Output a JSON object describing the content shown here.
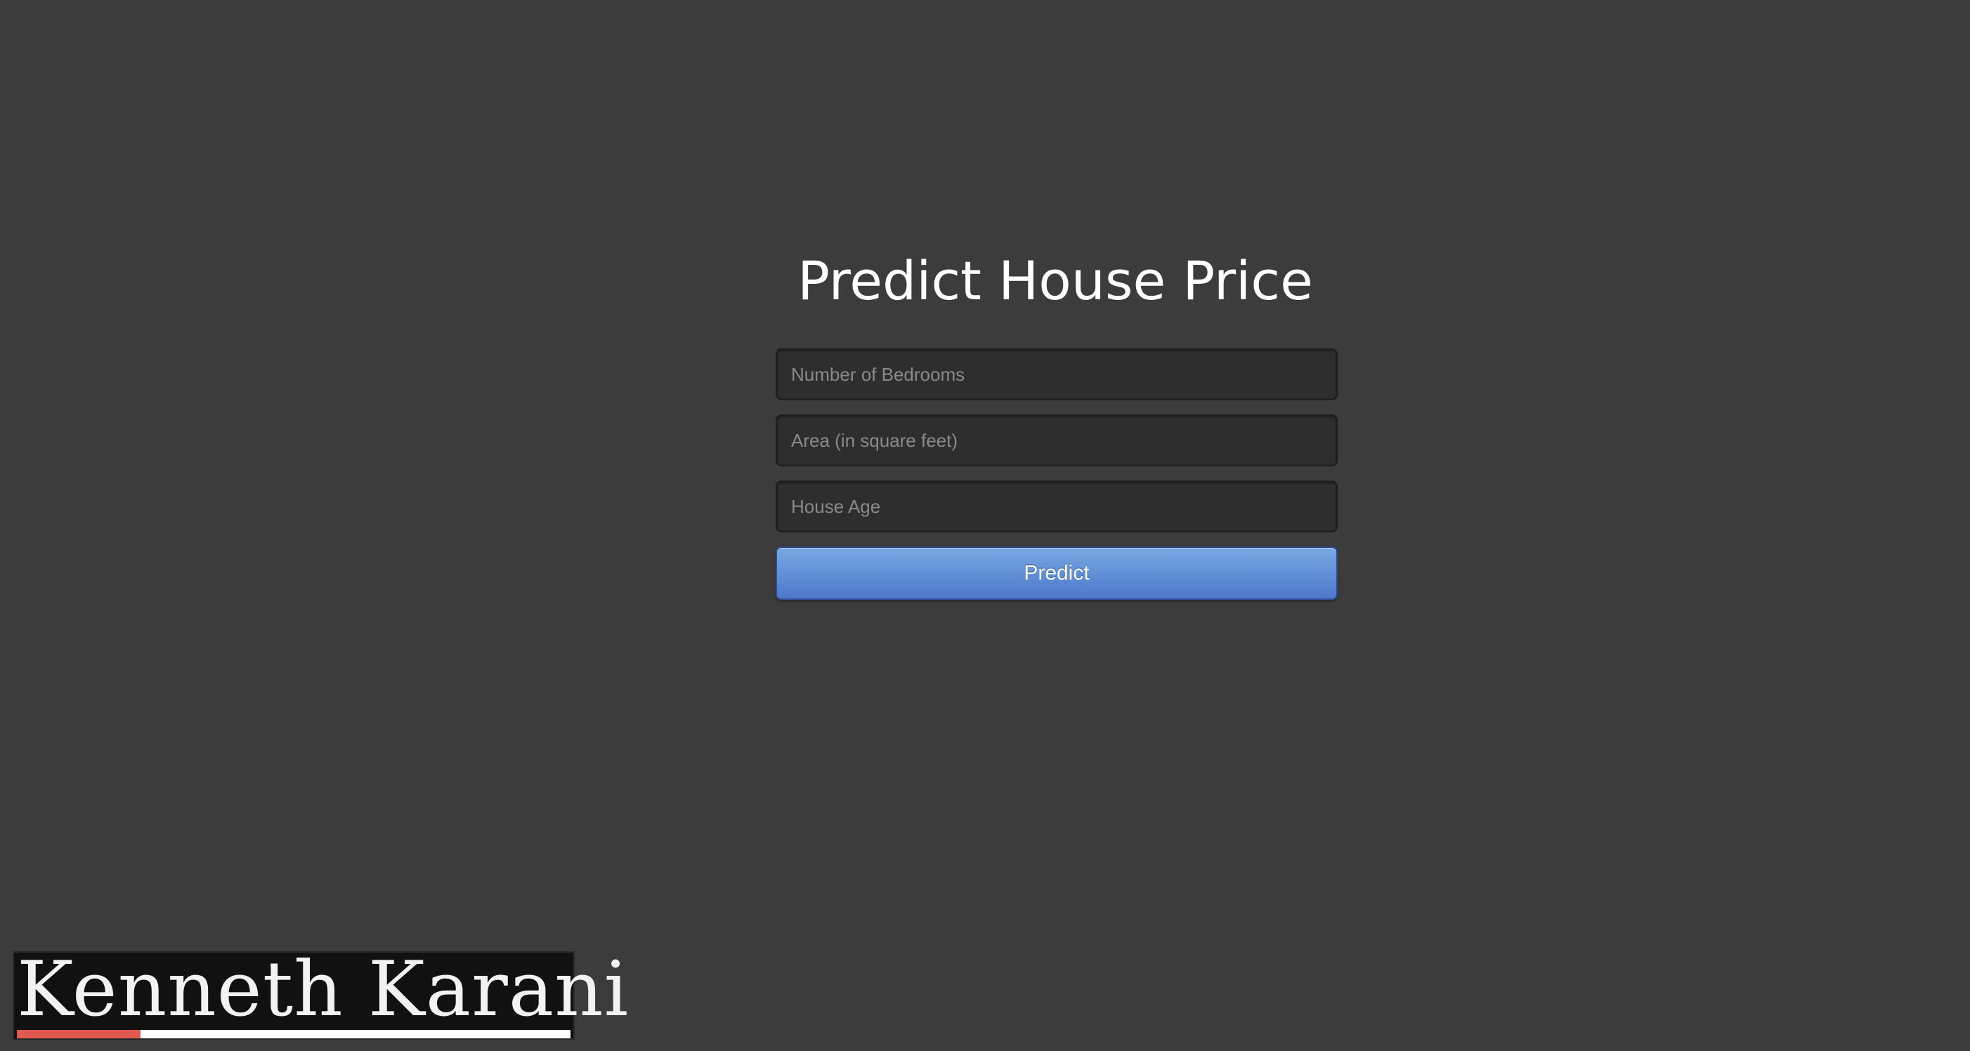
{
  "header": {
    "title": "Predict House Price"
  },
  "form": {
    "bedrooms_placeholder": "Number of Bedrooms",
    "bedrooms_value": "",
    "area_placeholder": "Area (in square feet)",
    "area_value": "",
    "age_placeholder": "House Age",
    "age_value": "",
    "submit_label": "Predict"
  },
  "signature": {
    "name": "Kenneth Karani",
    "accent_color": "#e05a52"
  },
  "colors": {
    "background": "#3c3c3c",
    "button": "#5f8ed6"
  }
}
